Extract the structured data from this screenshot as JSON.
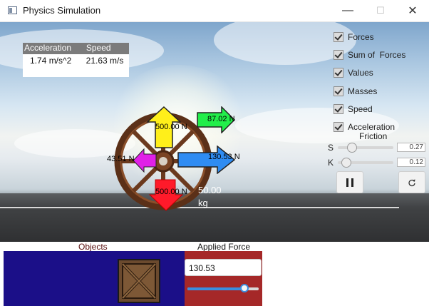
{
  "window": {
    "title": "Physics Simulation",
    "controls": {
      "minimize": "—",
      "maximize": "☐",
      "close": "✕"
    }
  },
  "readout": {
    "headers": {
      "acceleration": "Acceleration",
      "speed": "Speed"
    },
    "values": {
      "acceleration": "1.74 m/s^2",
      "speed": "21.63 m/s"
    }
  },
  "options": {
    "checkboxes": [
      {
        "label": "Forces",
        "checked": true
      },
      {
        "label": "Sum of  Forces",
        "checked": true
      },
      {
        "label": "Values",
        "checked": true
      },
      {
        "label": "Masses",
        "checked": true
      },
      {
        "label": "Speed",
        "checked": true
      },
      {
        "label": "Acceleration",
        "checked": true
      }
    ]
  },
  "friction": {
    "title": "Friction",
    "static": {
      "label": "S",
      "value": "0.27"
    },
    "kinetic": {
      "label": "K",
      "value": "0.12"
    }
  },
  "controls": {
    "pause_icon": "pause-icon",
    "reset_icon": "reset-icon"
  },
  "forces": {
    "normal": "500.00 N",
    "gravity": "500.00 N",
    "applied": "130.53 N",
    "friction": "43.51 N",
    "net": "87.02 N"
  },
  "object": {
    "mass_value": "50.00",
    "mass_unit": "kg"
  },
  "bottom": {
    "objects_label": "Objects",
    "applied_label": "Applied Force",
    "applied_value": "130.53",
    "applied_slider_fraction": 0.82
  },
  "colors": {
    "normal_arrow": "#ffef1a",
    "gravity_arrow": "#ff1a2a",
    "applied_arrow": "#2f8cf2",
    "friction_arrow": "#e020e8",
    "net_arrow": "#22ee4a",
    "objects_panel": "#1b0f88",
    "force_panel": "#a52828"
  }
}
